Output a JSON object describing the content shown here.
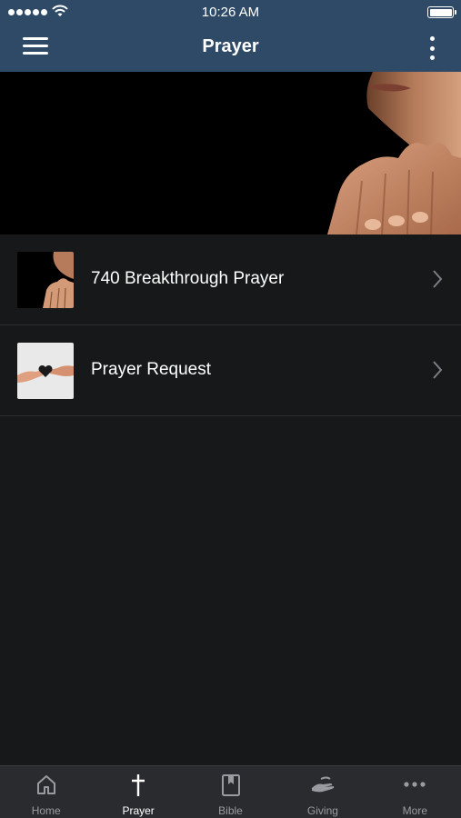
{
  "status_bar": {
    "time": "10:26 AM"
  },
  "nav": {
    "title": "Prayer"
  },
  "list": {
    "items": [
      {
        "label": "740 Breakthrough Prayer"
      },
      {
        "label": "Prayer Request"
      }
    ]
  },
  "tabbar": {
    "tabs": [
      {
        "label": "Home",
        "icon": "home-icon"
      },
      {
        "label": "Prayer",
        "icon": "cross-icon",
        "active": true
      },
      {
        "label": "Bible",
        "icon": "bible-icon"
      },
      {
        "label": "Giving",
        "icon": "giving-hand-icon"
      },
      {
        "label": "More",
        "icon": "more-dots-icon"
      }
    ]
  },
  "colors": {
    "header": "#2e4a66",
    "background": "#17181a",
    "tabbar": "#2a2b2e",
    "inactive_tab": "#9a9ba0"
  }
}
